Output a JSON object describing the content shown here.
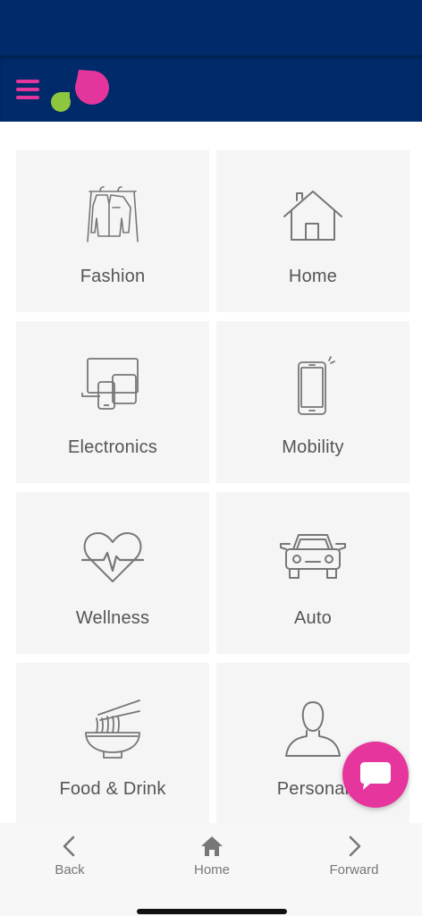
{
  "colors": {
    "header_bg": "#002a6a",
    "accent_pink": "#e4359c",
    "accent_green": "#8dc63f",
    "tile_bg": "#f5f5f5",
    "icon_gray": "#777777"
  },
  "header": {
    "menu_icon": "hamburger-menu-icon",
    "logo_icon": "brand-drops-logo"
  },
  "categories": [
    {
      "label": "Fashion",
      "icon": "clothes-rack-icon"
    },
    {
      "label": "Home",
      "icon": "house-icon"
    },
    {
      "label": "Electronics",
      "icon": "devices-icon"
    },
    {
      "label": "Mobility",
      "icon": "smartphone-icon"
    },
    {
      "label": "Wellness",
      "icon": "heart-pulse-icon"
    },
    {
      "label": "Auto",
      "icon": "car-icon"
    },
    {
      "label": "Food & Drink",
      "icon": "noodle-bowl-icon"
    },
    {
      "label": "Personal",
      "icon": "person-icon"
    }
  ],
  "chat": {
    "icon": "chat-bubble-icon"
  },
  "bottom_nav": {
    "back": {
      "label": "Back",
      "icon": "chevron-left-icon"
    },
    "home": {
      "label": "Home",
      "icon": "home-icon"
    },
    "forward": {
      "label": "Forward",
      "icon": "chevron-right-icon"
    }
  }
}
